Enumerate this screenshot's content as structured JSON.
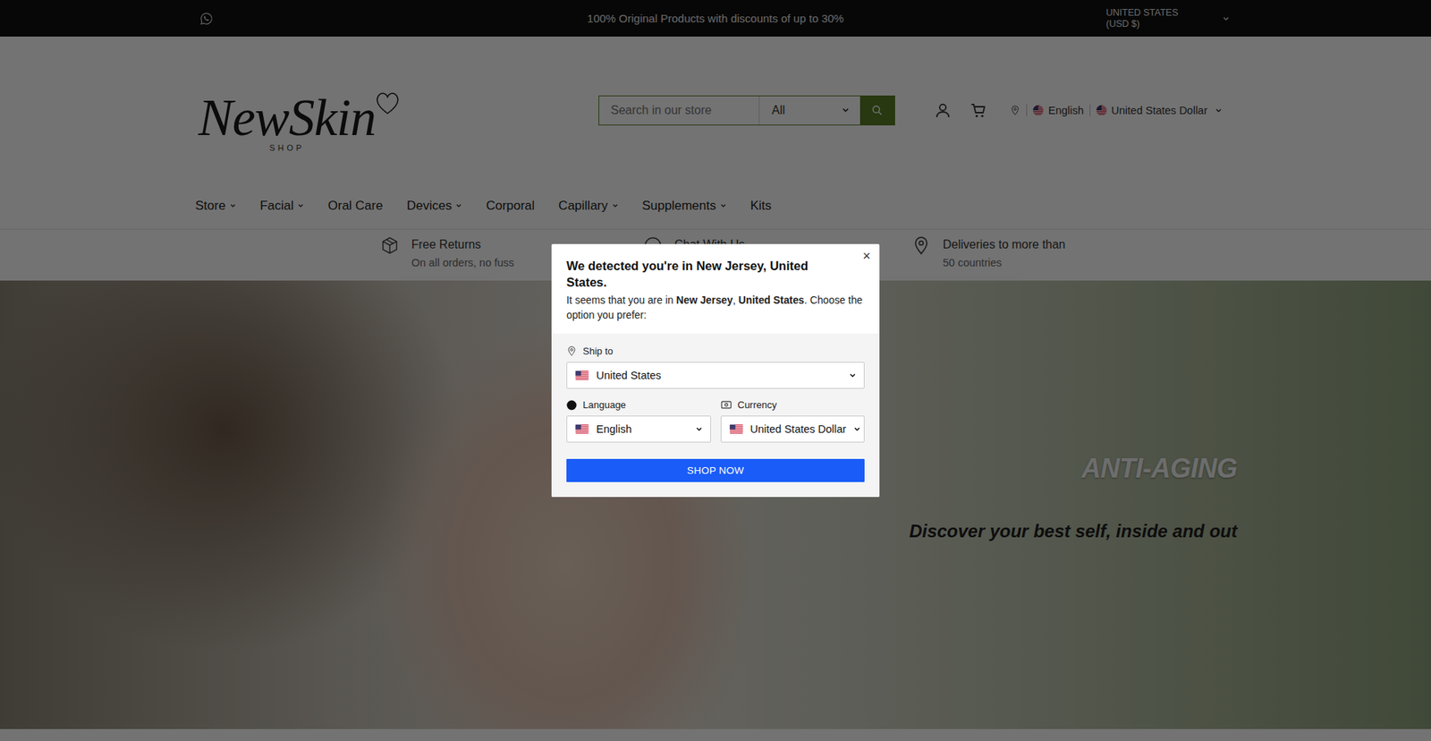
{
  "announcement": {
    "text": "100% Original Products with discounts of up to 30%",
    "region": "UNITED STATES",
    "region_currency": "(USD $)"
  },
  "logo": {
    "name": "NewSkin",
    "tagline": "SHOP"
  },
  "search": {
    "placeholder": "Search in our store",
    "category": "All"
  },
  "locale": {
    "language": "English",
    "currency": "United States Dollar"
  },
  "nav": [
    {
      "label": "Store",
      "has_menu": true
    },
    {
      "label": "Facial",
      "has_menu": true
    },
    {
      "label": "Oral Care",
      "has_menu": false
    },
    {
      "label": "Devices",
      "has_menu": true
    },
    {
      "label": "Corporal",
      "has_menu": false
    },
    {
      "label": "Capillary",
      "has_menu": true
    },
    {
      "label": "Supplements",
      "has_menu": true
    },
    {
      "label": "Kits",
      "has_menu": false
    }
  ],
  "features": [
    {
      "kind": "box",
      "title": "Free Returns",
      "subtitle": "On all orders, no fuss"
    },
    {
      "kind": "chat",
      "title": "Chat With Us"
    },
    {
      "kind": "pin",
      "title": "Deliveries to more than",
      "subtitle": "50 countries"
    }
  ],
  "hero": {
    "title": "ANTI-AGING",
    "subtitle": "Discover your best self, inside and out"
  },
  "modal": {
    "title": "We detected you're in New Jersey, United States.",
    "intro_prefix": "It seems that you are in ",
    "region": "New Jersey",
    "separator": ", ",
    "country": "United States",
    "intro_suffix": ". Choose the option you prefer:",
    "close": "×",
    "ship_to_label": "Ship to",
    "ship_to": "United States",
    "language_label": "Language",
    "language": "English",
    "currency_label": "Currency",
    "currency": "United States Dollar",
    "button": "SHOP NOW"
  }
}
